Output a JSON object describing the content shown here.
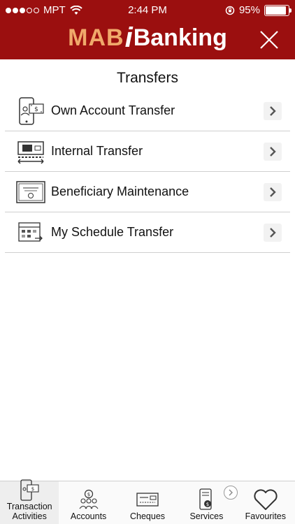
{
  "status_bar": {
    "carrier": "MPT",
    "time": "2:44 PM",
    "battery_text": "95%",
    "battery_level": 0.95
  },
  "header": {
    "logo_mab": "MAB",
    "logo_i": "i",
    "logo_banking": "Banking",
    "accent_color": "#9b0f0f",
    "logo_mab_color": "#f0a96b"
  },
  "page": {
    "title": "Transfers"
  },
  "menu": {
    "items": [
      {
        "label": "Own Account Transfer",
        "icon": "phone-transfer-icon"
      },
      {
        "label": "Internal Transfer",
        "icon": "bank-transfer-icon"
      },
      {
        "label": "Beneficiary Maintenance",
        "icon": "certificate-icon"
      },
      {
        "label": "My Schedule Transfer",
        "icon": "calendar-transfer-icon"
      }
    ]
  },
  "tabbar": {
    "tabs": [
      {
        "label": "Transaction Activities",
        "icon": "phone-transfer-icon",
        "active": true
      },
      {
        "label": "Accounts",
        "icon": "people-dollar-icon",
        "active": false
      },
      {
        "label": "Cheques",
        "icon": "cheque-icon",
        "active": false
      },
      {
        "label": "Services",
        "icon": "phone-services-icon",
        "active": false
      },
      {
        "label": "Favourites",
        "icon": "heart-icon",
        "active": false
      }
    ]
  }
}
